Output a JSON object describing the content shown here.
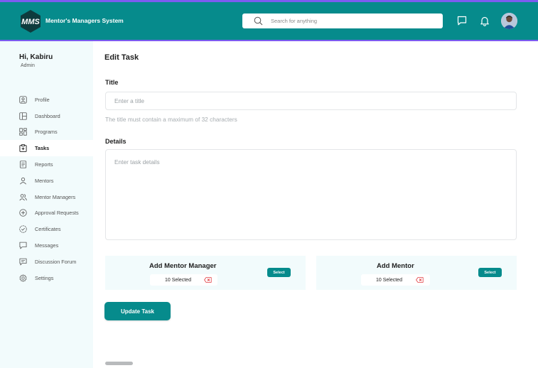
{
  "colors": {
    "brand": "#068b8c",
    "accent_border": "#7c5cf0",
    "sidebar_bg": "#f2fbfc",
    "remove_red": "#e0393e"
  },
  "header": {
    "logo_text": "MMS",
    "app_name": "Mentor's Managers System",
    "search": {
      "placeholder": "Search for anything",
      "value": ""
    },
    "icons": [
      "chat-icon",
      "bell-icon",
      "avatar"
    ]
  },
  "sidebar": {
    "greeting": "Hi, Kabiru",
    "role": "Admin",
    "items": [
      {
        "label": "Profile",
        "icon": "profile-icon",
        "active": false
      },
      {
        "label": "Dashboard",
        "icon": "dashboard-icon",
        "active": false
      },
      {
        "label": "Programs",
        "icon": "programs-icon",
        "active": false
      },
      {
        "label": "Tasks",
        "icon": "tasks-icon",
        "active": true
      },
      {
        "label": "Reports",
        "icon": "reports-icon",
        "active": false
      },
      {
        "label": "Mentors",
        "icon": "mentors-icon",
        "active": false
      },
      {
        "label": "Mentor Managers",
        "icon": "mentor-managers-icon",
        "active": false
      },
      {
        "label": "Approval Requests",
        "icon": "approval-icon",
        "active": false
      },
      {
        "label": "Certificates",
        "icon": "certificate-icon",
        "active": false
      },
      {
        "label": "Messages",
        "icon": "messages-icon",
        "active": false
      },
      {
        "label": "Discussion Forum",
        "icon": "forum-icon",
        "active": false
      },
      {
        "label": "Settings",
        "icon": "settings-icon",
        "active": false
      }
    ]
  },
  "main": {
    "page_title": "Edit Task",
    "title_label": "Title",
    "title_placeholder": "Enter a title",
    "title_value": "",
    "title_hint": "The title must contain a maximum of 32 characters",
    "details_label": "Details",
    "details_placeholder": "Enter task details",
    "details_value": "",
    "mentor_manager": {
      "title": "Add Mentor Manager",
      "selected": "10 Selected",
      "button": "Select"
    },
    "mentor": {
      "title": "Add Mentor",
      "selected": "10 Selected",
      "button": "Select"
    },
    "submit_label": "Update Task"
  }
}
